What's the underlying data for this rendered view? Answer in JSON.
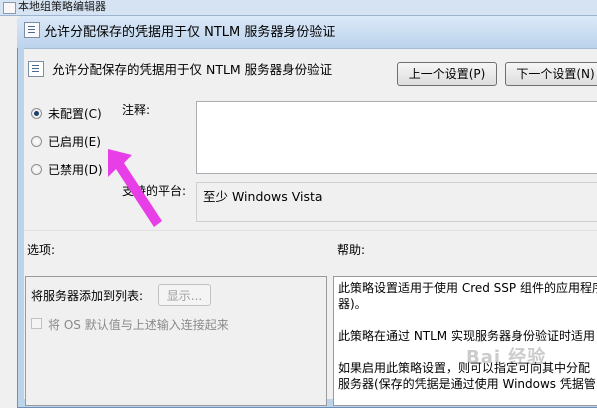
{
  "parent_window": {
    "title": "本地组策略编辑器"
  },
  "dialog": {
    "title": "允许分配保存的凭据用于仅 NTLM 服务器身份验证",
    "header_title": "允许分配保存的凭据用于仅 NTLM 服务器身份验证",
    "prev_button": "上一个设置(P)",
    "next_button": "下一个设置(N)",
    "state_options": [
      {
        "label": "未配置(C)",
        "selected": true
      },
      {
        "label": "已启用(E)",
        "selected": false
      },
      {
        "label": "已禁用(D)",
        "selected": false
      }
    ],
    "comment_label": "注释:",
    "comment_value": "",
    "supported_label": "支持的平台:",
    "supported_value": "至少 Windows Vista",
    "options_label": "选项:",
    "help_label": "帮助:",
    "options": {
      "add_servers_label": "将服务器添加到列表:",
      "show_button": "显示...",
      "concat_checkbox_label": "将 OS 默认值与上述输入连接起来",
      "concat_checked": false
    },
    "help_lines": [
      "此策略设置适用于使用 Cred SSP 组件的应用程序",
      "器)。",
      "此策略在通过 NTLM 实现服务器身份验证时适用",
      "如果启用此策略设置，则可以指定可向其中分配",
      "服务器(保存的凭据是通过使用 Windows 凭据管"
    ]
  },
  "annotation": {
    "arrow_color": "#e83ee8"
  },
  "watermark": {
    "text": "Bai 经验"
  }
}
